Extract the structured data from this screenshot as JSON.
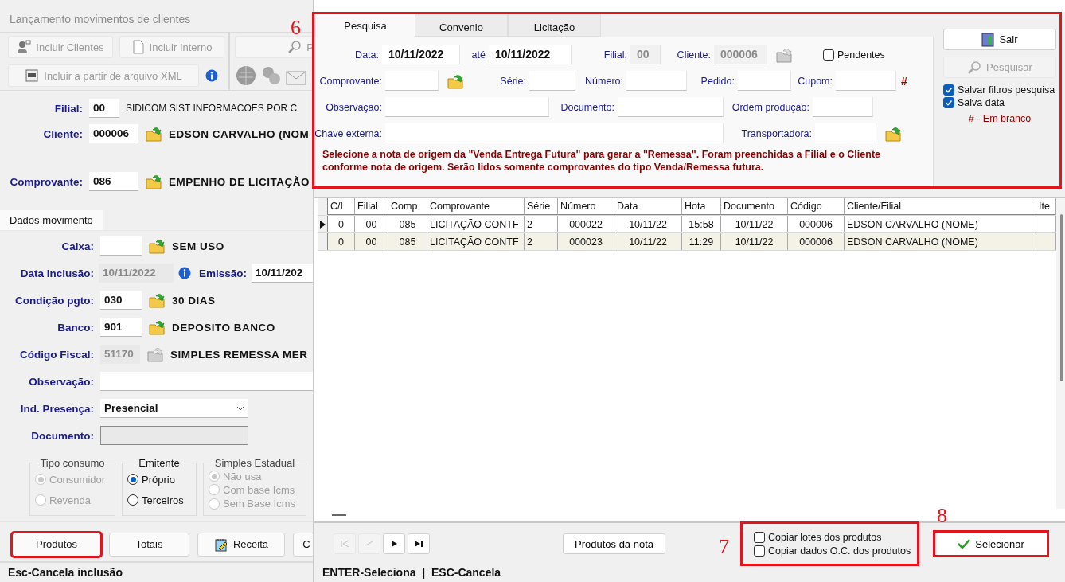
{
  "main_window": {
    "title": "Lançamento movimentos de clientes",
    "toolbar": [
      {
        "kind": "user",
        "label": "Incluir Clientes",
        "disabled": true
      },
      {
        "kind": "document",
        "label": "Incluir Interno",
        "disabled": true
      },
      {
        "kind": "xml",
        "label": "Incluir a partir de arquivo XML",
        "disabled": true
      },
      {
        "kind": "search",
        "label": "P",
        "disabled": true
      }
    ],
    "header_fields": [
      {
        "kind": "plain",
        "label": "Filial:",
        "value": "00",
        "description": "SIDICOM SIST INFORMACOES POR C"
      },
      {
        "kind": "lookup",
        "label": "Cliente:",
        "value": "000006",
        "description": "EDSON CARVALHO (NOM"
      },
      {
        "kind": "lookup",
        "label": "Comprovante:",
        "value": "086",
        "description": "EMPENHO DE LICITAÇÃO"
      }
    ],
    "tab": "Dados movimento",
    "fields": [
      {
        "kind": "lookup",
        "label": "Caixa:",
        "disabled": false,
        "description": "SEM USO"
      },
      {
        "kind": "dates",
        "label": "Data Inclusão:",
        "value": "10/11/2022",
        "disabled": true,
        "label_2": "Emissão:",
        "value_2": "10/11/202"
      },
      {
        "kind": "lookup",
        "label": "Condição pgto:",
        "value": "030",
        "disabled": false,
        "description": "30 DIAS"
      },
      {
        "kind": "lookup",
        "label": "Banco:",
        "value": "901",
        "disabled": false,
        "description": "DEPOSITO BANCO"
      },
      {
        "kind": "lookup",
        "label": "Código Fiscal:",
        "value": "51170",
        "disabled": true,
        "description": "SIMPLES REMESSA MER"
      },
      {
        "kind": "text",
        "label": "Observação:",
        "disabled": false
      },
      {
        "kind": "select",
        "label": "Ind. Presença:",
        "value": "Presencial",
        "disabled": false
      },
      {
        "kind": "text",
        "label": "Documento:",
        "disabled": true
      }
    ],
    "radio_groups": [
      {
        "title": "Tipo consumo",
        "disabled": true,
        "options": [
          {
            "label": "Consumidor",
            "selected": true
          },
          {
            "label": "Revenda",
            "selected": false
          }
        ]
      },
      {
        "title": "Emitente",
        "disabled": false,
        "options": [
          {
            "label": "Próprio",
            "selected": true
          },
          {
            "label": "Terceiros",
            "selected": false
          }
        ]
      },
      {
        "title": "Simples Estadual",
        "disabled": true,
        "options": [
          {
            "label": "Não usa",
            "selected": true
          },
          {
            "label": "Com base Icms",
            "selected": false
          },
          {
            "label": "Sem Base Icms",
            "selected": false
          }
        ]
      }
    ],
    "buttons": [
      {
        "kind": "plain",
        "label": "Produtos",
        "highlighted": true
      },
      {
        "kind": "plain",
        "label": "Totais",
        "highlighted": false
      },
      {
        "kind": "recipe",
        "label": "Receita",
        "highlighted": false
      },
      {
        "kind": "plain",
        "label": "C",
        "highlighted": false
      }
    ],
    "status_bar": "Esc-Cancela inclusão"
  },
  "search_dialog": {
    "filters_panel": {
      "highlighted": true,
      "annotation": "6",
      "tabs": [
        {
          "label": "Pesquisa",
          "selected": true
        },
        {
          "label": "Convenio",
          "selected": false
        },
        {
          "label": "Licitação",
          "selected": false
        }
      ],
      "filter_rows": [
        [
          {
            "kind": "field",
            "label": "Data:",
            "value": "10/11/2022",
            "disabled": false
          },
          {
            "kind": "field",
            "label": "até",
            "value": "10/11/2022",
            "disabled": false
          },
          {
            "kind": "field",
            "label": "Filial:",
            "value": "00",
            "disabled": true
          },
          {
            "kind": "field",
            "label": "Cliente:",
            "value": "000006",
            "disabled": true
          },
          {
            "kind": "folder",
            "disabled": true
          },
          {
            "kind": "checkbox",
            "label": "Pendentes",
            "checked": false
          }
        ],
        [
          {
            "kind": "field",
            "label": "Comprovante:",
            "disabled": false
          },
          {
            "kind": "folder",
            "disabled": false
          },
          {
            "kind": "field",
            "label": "Série:",
            "disabled": false
          },
          {
            "kind": "field",
            "label": "Número:",
            "disabled": false
          },
          {
            "kind": "field",
            "label": "Pedido:",
            "disabled": false
          },
          {
            "kind": "field",
            "label": "Cupom:",
            "disabled": false
          },
          {
            "kind": "mark",
            "label": "#"
          }
        ],
        [
          {
            "kind": "field",
            "label": "Observação:",
            "disabled": false
          },
          {
            "kind": "field",
            "label": "Documento:",
            "disabled": false
          },
          {
            "kind": "field",
            "label": "Ordem produção:",
            "disabled": false
          }
        ],
        [
          {
            "kind": "field",
            "label": "Chave externa:",
            "disabled": false
          },
          {
            "kind": "field",
            "label": "Transportadora:",
            "disabled": false
          },
          {
            "kind": "folder",
            "disabled": false
          }
        ]
      ],
      "message": "Selecione a nota de origem da \"Venda Entrega Futura\" para gerar a \"Remessa\". Foram preenchidas a Filial e o Cliente conforme nota de origem. Serão lidos somente comprovantes do tipo Venda/Remessa futura.",
      "actions": [
        {
          "kind": "exit",
          "label": "Sair",
          "disabled": false
        },
        {
          "kind": "search",
          "label": "Pesquisar",
          "disabled": true
        }
      ],
      "options": [
        {
          "label": "Salvar filtros pesquisa",
          "checked": true
        },
        {
          "label": "Salva data",
          "checked": true
        }
      ],
      "legend": "# - Em branco"
    },
    "table": {
      "columns": [
        "C/I",
        "Filial",
        "Comp",
        "Comprovante",
        "Série",
        "Número",
        "Data",
        "Hota",
        "Documento",
        "Código",
        "Cliente/Filial",
        "Ite"
      ],
      "rows": [
        {
          "selected": true,
          "cells": [
            "0",
            "00",
            "085",
            "LICITAÇÃO CONTF",
            "2",
            "000022",
            "10/11/22",
            "15:58",
            "10/11/22",
            "000006",
            "EDSON CARVALHO (NOME)",
            null
          ]
        },
        {
          "selected": false,
          "cells": [
            "0",
            "00",
            "085",
            "LICITAÇÃO CONTF",
            "2",
            "000023",
            "10/11/22",
            "11:29",
            "10/11/22",
            "000006",
            "EDSON CARVALHO (NOME)",
            null
          ]
        }
      ]
    },
    "navigator": [
      {
        "kind": "first",
        "disabled": true
      },
      {
        "kind": "prior",
        "disabled": true
      },
      {
        "kind": "next",
        "disabled": false
      },
      {
        "kind": "last",
        "disabled": false
      }
    ],
    "products_button": "Produtos da nota",
    "copy_options": {
      "highlighted": true,
      "annotation": "7",
      "items": [
        {
          "label": "Copiar lotes dos produtos",
          "checked": false
        },
        {
          "label": "Copiar dados O.C. dos produtos",
          "checked": false
        }
      ]
    },
    "select_button": {
      "label": "Selecionar",
      "highlighted": true,
      "annotation": "8"
    },
    "status_bar": "ENTER-Seleciona  |  ESC-Cancela"
  }
}
